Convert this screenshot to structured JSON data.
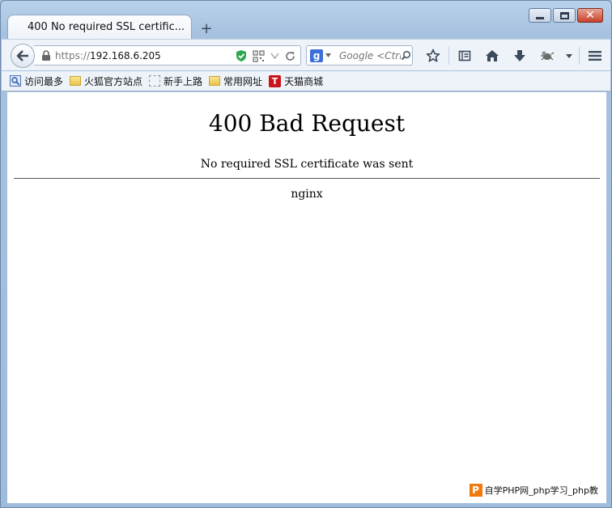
{
  "tab": {
    "title": "400 No required SSL certific...",
    "new_tab_symbol": "+"
  },
  "urlbar": {
    "scheme": "https://",
    "host": "192.168.6.205"
  },
  "searchbar": {
    "engine_glyph": "g",
    "placeholder": "Google <Ctrl+K>"
  },
  "bookmarks": [
    {
      "label": "访问最多",
      "icon": "most-visited-icon"
    },
    {
      "label": "火狐官方站点",
      "icon": "folder-icon"
    },
    {
      "label": "新手上路",
      "icon": "dashed-page-icon"
    },
    {
      "label": "常用网址",
      "icon": "folder-icon"
    },
    {
      "label": "天猫商城",
      "icon": "tmall-icon",
      "icon_text": "T"
    }
  ],
  "page": {
    "title": "400 Bad Request",
    "message": "No required SSL certificate was sent",
    "server": "nginx"
  },
  "watermark": {
    "badge": "P",
    "text": "自学PHP网_php学习_php教"
  },
  "colors": {
    "accent": "#3d6fd9",
    "shield": "#2fa84f",
    "close": "#c8412c",
    "tmall": "#c8141b",
    "watermark": "#f07a10"
  }
}
